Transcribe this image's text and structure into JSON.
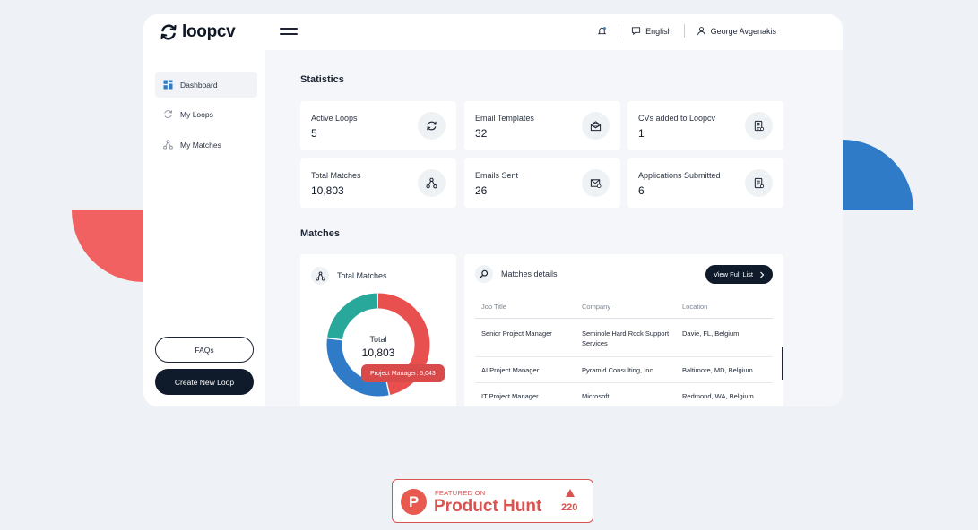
{
  "brand": {
    "name": "loopcv"
  },
  "header": {
    "language": "English",
    "user_name": "George Avgenakis"
  },
  "sidebar": {
    "items": [
      {
        "label": "Dashboard",
        "icon": "dashboard-icon",
        "active": true
      },
      {
        "label": "My Loops",
        "icon": "loop-icon",
        "active": false
      },
      {
        "label": "My Matches",
        "icon": "matches-icon",
        "active": false
      }
    ],
    "faq_label": "FAQs",
    "create_label": "Create New Loop"
  },
  "statistics": {
    "title": "Statistics",
    "cards": [
      {
        "label": "Active Loops",
        "value": "5",
        "icon": "refresh-icon"
      },
      {
        "label": "Email Templates",
        "value": "32",
        "icon": "email-template-icon"
      },
      {
        "label": "CVs added to Loopcv",
        "value": "1",
        "icon": "cv-document-icon"
      },
      {
        "label": "Total Matches",
        "value": "10,803",
        "icon": "network-icon"
      },
      {
        "label": "Emails Sent",
        "value": "26",
        "icon": "email-sent-icon"
      },
      {
        "label": "Applications Submitted",
        "value": "6",
        "icon": "application-icon"
      }
    ]
  },
  "matches": {
    "title": "Matches",
    "donut": {
      "title": "Total Matches",
      "center_label": "Total",
      "center_value": "10,803",
      "tooltip": "Project Manager: 5,043",
      "segments": [
        {
          "value": 5043,
          "color": "#e8504f"
        },
        {
          "value": 3300,
          "color": "#2f7bc8"
        },
        {
          "value": 2460,
          "color": "#27a89a"
        }
      ]
    },
    "details": {
      "title": "Matches details",
      "view_label": "View Full List",
      "columns": [
        "Job Title",
        "Company",
        "Location"
      ],
      "rows": [
        {
          "title": "Senior Project Manager",
          "company": "Seminole Hard Rock Support Services",
          "location": "Davie, FL, Belgium"
        },
        {
          "title": "AI Project Manager",
          "company": "Pyramid Consulting, Inc",
          "location": "Baltimore, MD, Belgium"
        },
        {
          "title": "IT Project Manager",
          "company": "Microsoft",
          "location": "Redmond, WA, Belgium"
        }
      ]
    }
  },
  "product_hunt": {
    "featured": "FEATURED ON",
    "name": "Product Hunt",
    "votes": "220",
    "color": "#d9534f"
  }
}
